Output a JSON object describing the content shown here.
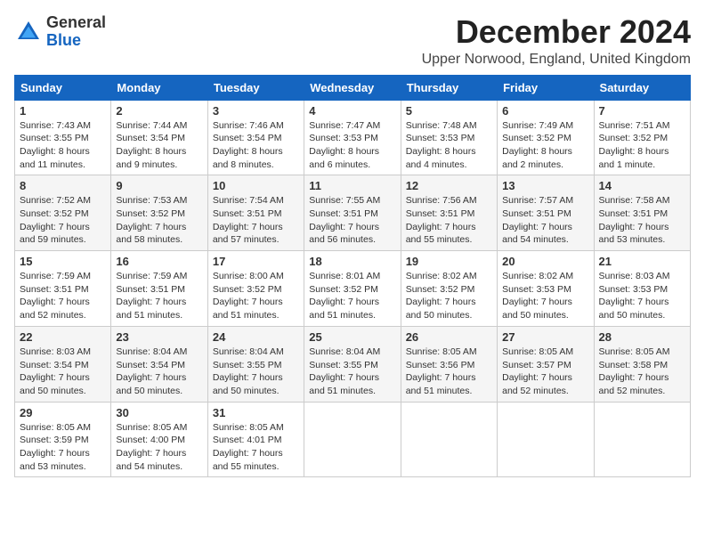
{
  "logo": {
    "general": "General",
    "blue": "Blue"
  },
  "title": "December 2024",
  "location": "Upper Norwood, England, United Kingdom",
  "days_of_week": [
    "Sunday",
    "Monday",
    "Tuesday",
    "Wednesday",
    "Thursday",
    "Friday",
    "Saturday"
  ],
  "weeks": [
    [
      {
        "day": "1",
        "sunrise": "Sunrise: 7:43 AM",
        "sunset": "Sunset: 3:55 PM",
        "daylight": "Daylight: 8 hours and 11 minutes."
      },
      {
        "day": "2",
        "sunrise": "Sunrise: 7:44 AM",
        "sunset": "Sunset: 3:54 PM",
        "daylight": "Daylight: 8 hours and 9 minutes."
      },
      {
        "day": "3",
        "sunrise": "Sunrise: 7:46 AM",
        "sunset": "Sunset: 3:54 PM",
        "daylight": "Daylight: 8 hours and 8 minutes."
      },
      {
        "day": "4",
        "sunrise": "Sunrise: 7:47 AM",
        "sunset": "Sunset: 3:53 PM",
        "daylight": "Daylight: 8 hours and 6 minutes."
      },
      {
        "day": "5",
        "sunrise": "Sunrise: 7:48 AM",
        "sunset": "Sunset: 3:53 PM",
        "daylight": "Daylight: 8 hours and 4 minutes."
      },
      {
        "day": "6",
        "sunrise": "Sunrise: 7:49 AM",
        "sunset": "Sunset: 3:52 PM",
        "daylight": "Daylight: 8 hours and 2 minutes."
      },
      {
        "day": "7",
        "sunrise": "Sunrise: 7:51 AM",
        "sunset": "Sunset: 3:52 PM",
        "daylight": "Daylight: 8 hours and 1 minute."
      }
    ],
    [
      {
        "day": "8",
        "sunrise": "Sunrise: 7:52 AM",
        "sunset": "Sunset: 3:52 PM",
        "daylight": "Daylight: 7 hours and 59 minutes."
      },
      {
        "day": "9",
        "sunrise": "Sunrise: 7:53 AM",
        "sunset": "Sunset: 3:52 PM",
        "daylight": "Daylight: 7 hours and 58 minutes."
      },
      {
        "day": "10",
        "sunrise": "Sunrise: 7:54 AM",
        "sunset": "Sunset: 3:51 PM",
        "daylight": "Daylight: 7 hours and 57 minutes."
      },
      {
        "day": "11",
        "sunrise": "Sunrise: 7:55 AM",
        "sunset": "Sunset: 3:51 PM",
        "daylight": "Daylight: 7 hours and 56 minutes."
      },
      {
        "day": "12",
        "sunrise": "Sunrise: 7:56 AM",
        "sunset": "Sunset: 3:51 PM",
        "daylight": "Daylight: 7 hours and 55 minutes."
      },
      {
        "day": "13",
        "sunrise": "Sunrise: 7:57 AM",
        "sunset": "Sunset: 3:51 PM",
        "daylight": "Daylight: 7 hours and 54 minutes."
      },
      {
        "day": "14",
        "sunrise": "Sunrise: 7:58 AM",
        "sunset": "Sunset: 3:51 PM",
        "daylight": "Daylight: 7 hours and 53 minutes."
      }
    ],
    [
      {
        "day": "15",
        "sunrise": "Sunrise: 7:59 AM",
        "sunset": "Sunset: 3:51 PM",
        "daylight": "Daylight: 7 hours and 52 minutes."
      },
      {
        "day": "16",
        "sunrise": "Sunrise: 7:59 AM",
        "sunset": "Sunset: 3:51 PM",
        "daylight": "Daylight: 7 hours and 51 minutes."
      },
      {
        "day": "17",
        "sunrise": "Sunrise: 8:00 AM",
        "sunset": "Sunset: 3:52 PM",
        "daylight": "Daylight: 7 hours and 51 minutes."
      },
      {
        "day": "18",
        "sunrise": "Sunrise: 8:01 AM",
        "sunset": "Sunset: 3:52 PM",
        "daylight": "Daylight: 7 hours and 51 minutes."
      },
      {
        "day": "19",
        "sunrise": "Sunrise: 8:02 AM",
        "sunset": "Sunset: 3:52 PM",
        "daylight": "Daylight: 7 hours and 50 minutes."
      },
      {
        "day": "20",
        "sunrise": "Sunrise: 8:02 AM",
        "sunset": "Sunset: 3:53 PM",
        "daylight": "Daylight: 7 hours and 50 minutes."
      },
      {
        "day": "21",
        "sunrise": "Sunrise: 8:03 AM",
        "sunset": "Sunset: 3:53 PM",
        "daylight": "Daylight: 7 hours and 50 minutes."
      }
    ],
    [
      {
        "day": "22",
        "sunrise": "Sunrise: 8:03 AM",
        "sunset": "Sunset: 3:54 PM",
        "daylight": "Daylight: 7 hours and 50 minutes."
      },
      {
        "day": "23",
        "sunrise": "Sunrise: 8:04 AM",
        "sunset": "Sunset: 3:54 PM",
        "daylight": "Daylight: 7 hours and 50 minutes."
      },
      {
        "day": "24",
        "sunrise": "Sunrise: 8:04 AM",
        "sunset": "Sunset: 3:55 PM",
        "daylight": "Daylight: 7 hours and 50 minutes."
      },
      {
        "day": "25",
        "sunrise": "Sunrise: 8:04 AM",
        "sunset": "Sunset: 3:55 PM",
        "daylight": "Daylight: 7 hours and 51 minutes."
      },
      {
        "day": "26",
        "sunrise": "Sunrise: 8:05 AM",
        "sunset": "Sunset: 3:56 PM",
        "daylight": "Daylight: 7 hours and 51 minutes."
      },
      {
        "day": "27",
        "sunrise": "Sunrise: 8:05 AM",
        "sunset": "Sunset: 3:57 PM",
        "daylight": "Daylight: 7 hours and 52 minutes."
      },
      {
        "day": "28",
        "sunrise": "Sunrise: 8:05 AM",
        "sunset": "Sunset: 3:58 PM",
        "daylight": "Daylight: 7 hours and 52 minutes."
      }
    ],
    [
      {
        "day": "29",
        "sunrise": "Sunrise: 8:05 AM",
        "sunset": "Sunset: 3:59 PM",
        "daylight": "Daylight: 7 hours and 53 minutes."
      },
      {
        "day": "30",
        "sunrise": "Sunrise: 8:05 AM",
        "sunset": "Sunset: 4:00 PM",
        "daylight": "Daylight: 7 hours and 54 minutes."
      },
      {
        "day": "31",
        "sunrise": "Sunrise: 8:05 AM",
        "sunset": "Sunset: 4:01 PM",
        "daylight": "Daylight: 7 hours and 55 minutes."
      },
      null,
      null,
      null,
      null
    ]
  ]
}
